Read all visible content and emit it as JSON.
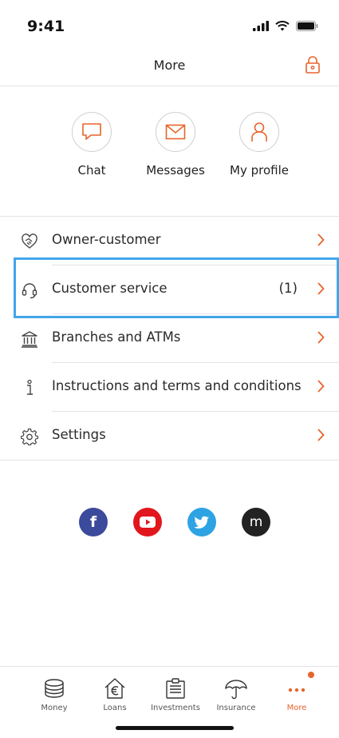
{
  "status_bar": {
    "time": "9:41"
  },
  "header": {
    "title": "More"
  },
  "quick_actions": [
    {
      "label": "Chat",
      "icon": "chat-icon"
    },
    {
      "label": "Messages",
      "icon": "envelope-icon"
    },
    {
      "label": "My profile",
      "icon": "person-icon"
    }
  ],
  "menu": [
    {
      "label": "Owner-customer",
      "icon": "handshake-icon",
      "badge": ""
    },
    {
      "label": "Customer service",
      "icon": "headset-icon",
      "badge": "(1)"
    },
    {
      "label": "Branches and ATMs",
      "icon": "bank-building-icon",
      "badge": ""
    },
    {
      "label": "Instructions and terms and conditions",
      "icon": "info-icon",
      "badge": ""
    },
    {
      "label": "Settings",
      "icon": "gear-icon",
      "badge": ""
    }
  ],
  "social": [
    {
      "label": "f",
      "icon": "facebook-icon",
      "color": "#3b4a9a"
    },
    {
      "label": "",
      "icon": "youtube-icon",
      "color": "#e2161d"
    },
    {
      "label": "",
      "icon": "twitter-icon",
      "color": "#2ea3e3"
    },
    {
      "label": "m",
      "icon": "medium-icon",
      "color": "#222222"
    }
  ],
  "tabbar": [
    {
      "label": "Money",
      "icon": "coins-icon"
    },
    {
      "label": "Loans",
      "icon": "house-euro-icon"
    },
    {
      "label": "Investments",
      "icon": "document-icon"
    },
    {
      "label": "Insurance",
      "icon": "umbrella-icon"
    },
    {
      "label": "More",
      "icon": "more-dots-icon",
      "active": true
    }
  ],
  "colors": {
    "accent": "#e8642b",
    "highlight": "#42a6ea",
    "separator": "#e3e3e3"
  }
}
